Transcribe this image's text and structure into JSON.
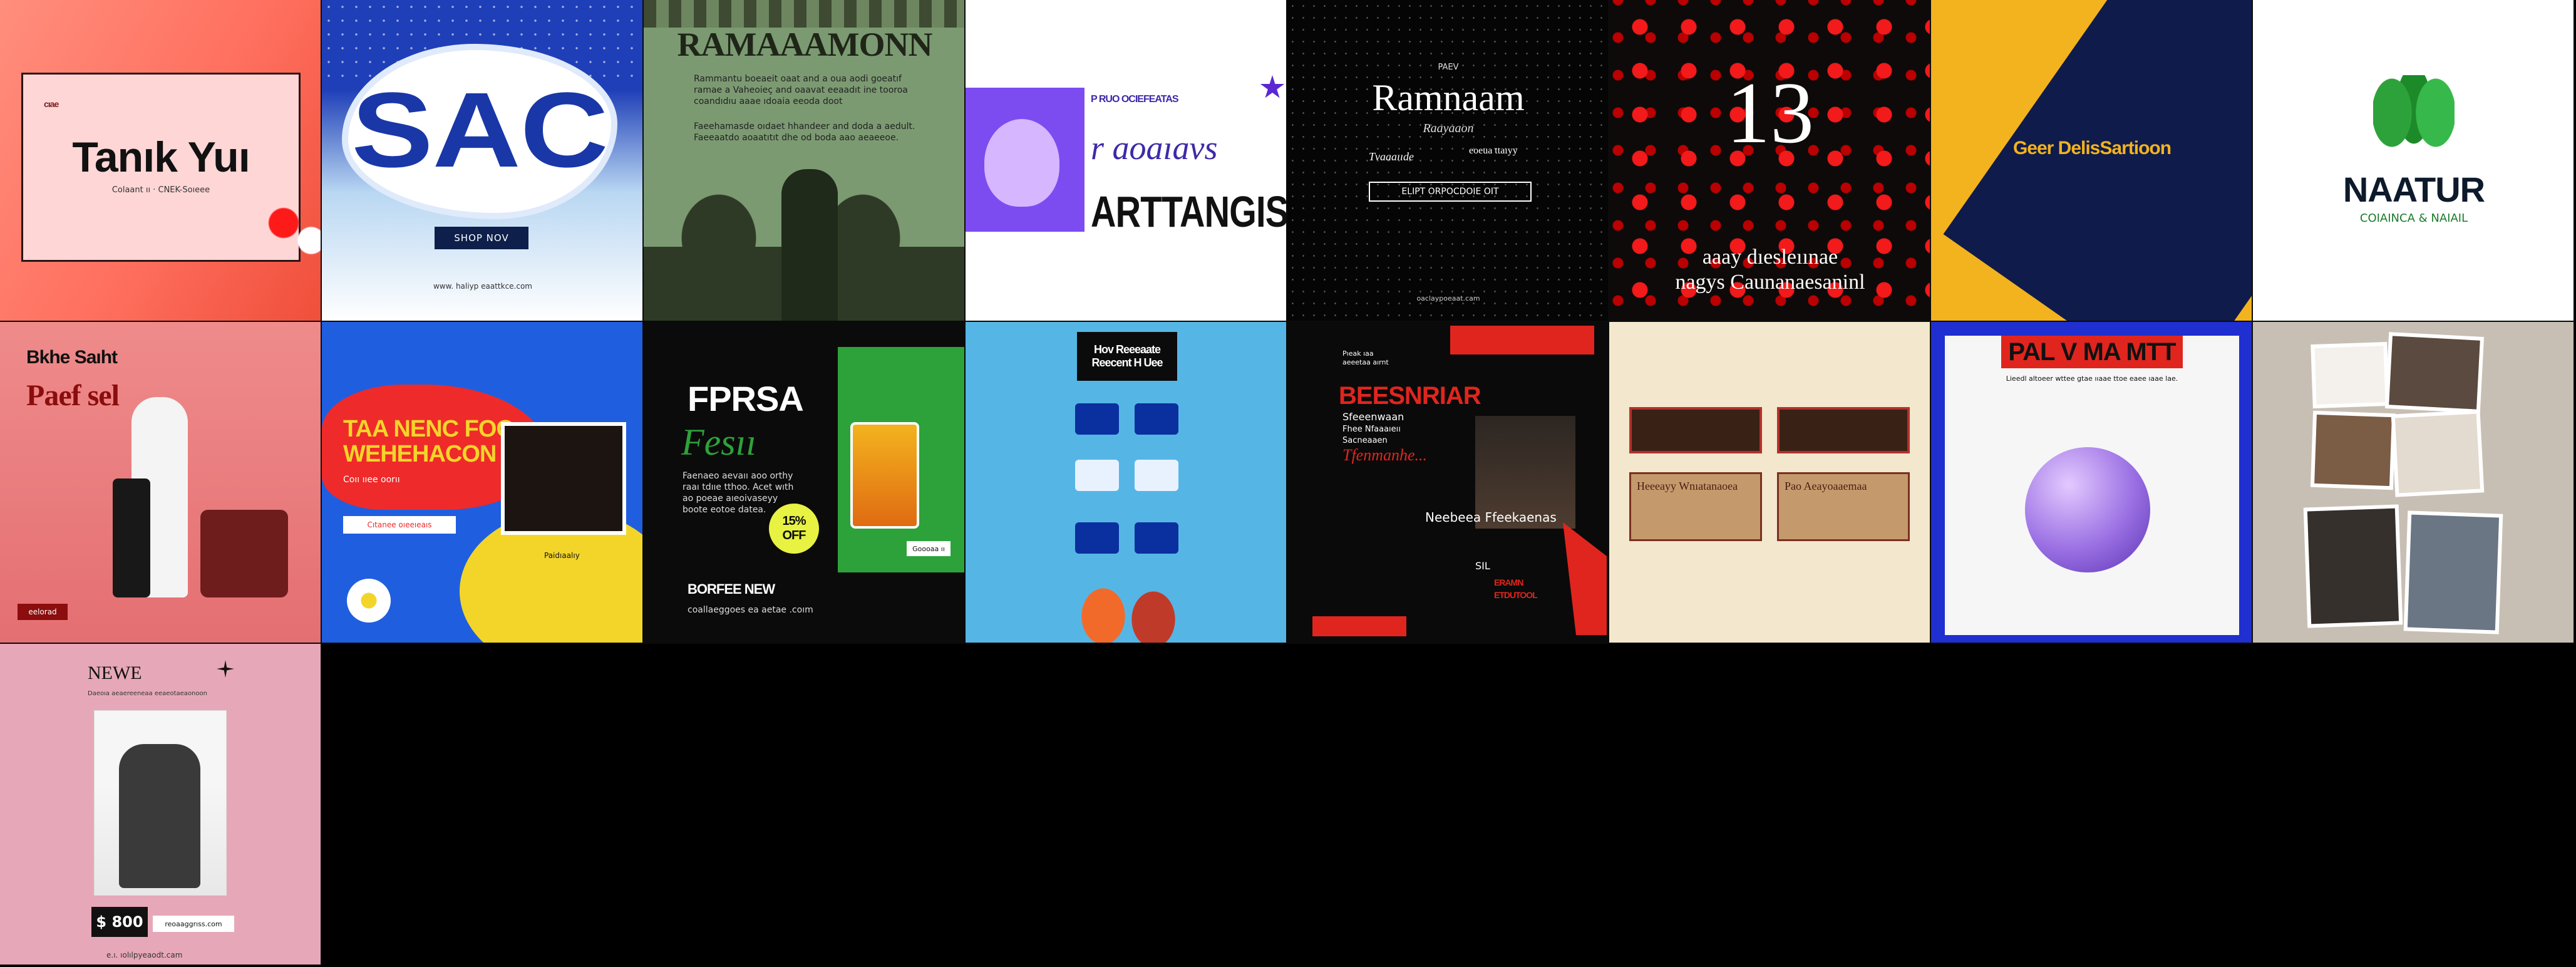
{
  "tiles": [
    {
      "id": "thank-you",
      "heading": "Tanık Yuı",
      "sub": "Colaant ıı · CNEK-Soıeee",
      "corner": "cıae"
    },
    {
      "id": "sale",
      "heading": "SAC",
      "button": "SHOP NOV",
      "url": "www. haliyp eaattkce.com"
    },
    {
      "id": "ramadan-green",
      "heading": "RAMAAAMONN",
      "line1": "Rammantu boeaeit oaat and a oua aodi goeatıf",
      "line2": "ramae a Vaheoieç and oaavat eeaadıt ine tooroa",
      "line3": "coandıdıu aaae ıdoaia eeoda doot",
      "line4": "Faeehamasde oıdaet hhandeer and doda a aedult.",
      "line5": "Faeeaatdo aoaatıtıt dhe od boda aao aeaeeoe."
    },
    {
      "id": "artangis",
      "heading": "ARTTANGIS",
      "tagline": "r aoaıavs",
      "small": "P RUO OCIEFEATAS"
    },
    {
      "id": "ramadan-night",
      "small": "PAEV",
      "heading": "Ramnaam",
      "script": "Raayaaon",
      "sub1": "Tvaaaııde",
      "sub2": "eoeua ttaıyy",
      "button": "ELIPT ORPOCDOIE OIT",
      "footer": "oaclaypoeaat.cam"
    },
    {
      "id": "bokeh-13",
      "number": "13",
      "line1": "aaay dıesleıınae",
      "line2": "nagys Caunanaesaninl"
    },
    {
      "id": "geometric",
      "heading": "Geer DelisSartioon"
    },
    {
      "id": "naatur",
      "heading": "NAATUR",
      "sub": "COIAINCA & NAIAIL"
    },
    {
      "id": "skincare",
      "heading1": "Bkhe Saıht",
      "heading2": "Paef sel",
      "badge": "eelorad"
    },
    {
      "id": "food",
      "heading1": "TAA NENC FOO",
      "heading2": "WEHEHACON",
      "sub": "Coıı ııee oorıı",
      "button": "Cıtanee oıeeıeaıs",
      "chip": "Paidıaalıy"
    },
    {
      "id": "fresh",
      "heading": "FPRSA",
      "script": "Fesıı",
      "body1": "Faenaeo aevaıı aoo orthy",
      "body2": "raaı tdııe tthoo. Acet wıth",
      "body3": "ao poeae aıeoivaseyy",
      "body4": "boote eotoe datea.",
      "discount1": "15%",
      "discount2": "OFF",
      "cta": "Goooaa ıı",
      "footer1": "BORFEE NEW",
      "footer2": "coallaeggoes ea aetae .coım"
    },
    {
      "id": "flowchart",
      "heading1": "Hov Reeeaate",
      "heading2": "Reecent H Uee"
    },
    {
      "id": "business",
      "small1": "Pıeak ıaa",
      "small2": "aeeetaa aırnt",
      "heading": "BEESNRIAR",
      "sub1": "Sfeeenwaan",
      "sub2": "Fhee Nfaaaıeıı",
      "sub3": "Sacneaaen",
      "script": "Tfenmanhe...",
      "caption": "Neebeea Ffeekaenas",
      "date": "SIL",
      "footer1": "ERAMN",
      "footer2": "ETDUTOOL"
    },
    {
      "id": "vintage",
      "caption1": "Heeeayy Wnıatanaoea",
      "caption2": "Pao Aeayoaaemaa"
    },
    {
      "id": "palmatt",
      "heading": "PAL V MA MTT",
      "sub": "Lieedl altoeer wttee gtae ııaae ttoe eaee ıaae lae."
    },
    {
      "id": "collage"
    },
    {
      "id": "newe",
      "heading": "NEWE",
      "sub": "Daeoıa aeaereeneaa eeaeotaeaonoon",
      "price": "$ 800",
      "chip": "reoaaggrıss.com",
      "footer": "e.ı. ıolılpyeaodt.cam"
    }
  ],
  "colors": {
    "black": "#000000",
    "ink": "#101010",
    "cream": "#f3e7cd",
    "skyblue": "#55b6e6",
    "red": "#e0251e",
    "yellow": "#f3b31e",
    "navy": "#0f1b4b",
    "green": "#2da23a"
  }
}
